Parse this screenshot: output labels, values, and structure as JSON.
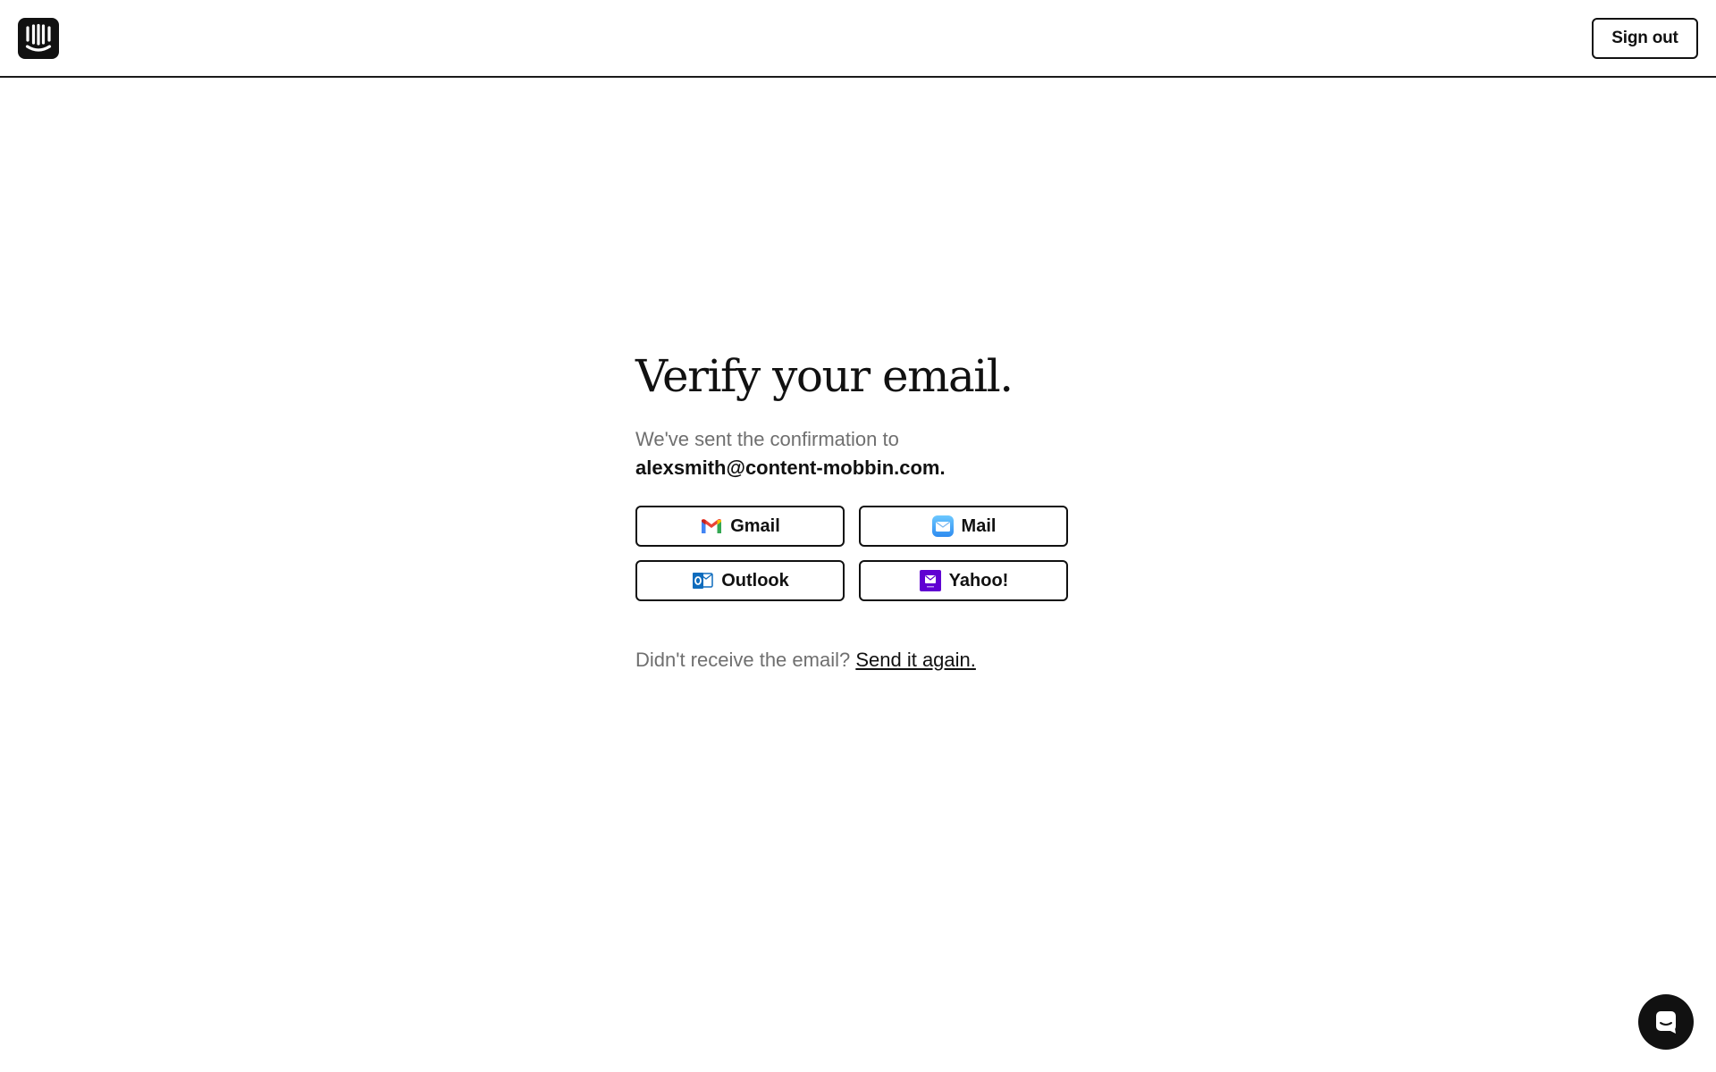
{
  "header": {
    "logo_icon": "intercom-logo-icon",
    "signout_label": "Sign out"
  },
  "main": {
    "title": "Verify your email.",
    "sent_text": "We've sent the confirmation to",
    "email": "alexsmith@content-mobbin.com.",
    "providers": [
      {
        "label": "Gmail",
        "icon": "gmail-icon"
      },
      {
        "label": "Mail",
        "icon": "mail-icon"
      },
      {
        "label": "Outlook",
        "icon": "outlook-icon"
      },
      {
        "label": "Yahoo!",
        "icon": "yahoo-icon"
      }
    ],
    "resend_prompt": "Didn't receive the email?",
    "resend_link": "Send it again."
  },
  "chat": {
    "icon": "chat-icon"
  },
  "colors": {
    "text": "#111111",
    "muted": "#6f6f6f",
    "gmail_red": "#EA4335",
    "mail_blue": "#3FA9F5",
    "outlook_blue": "#0F6CBD",
    "yahoo_purple": "#6001D2"
  }
}
